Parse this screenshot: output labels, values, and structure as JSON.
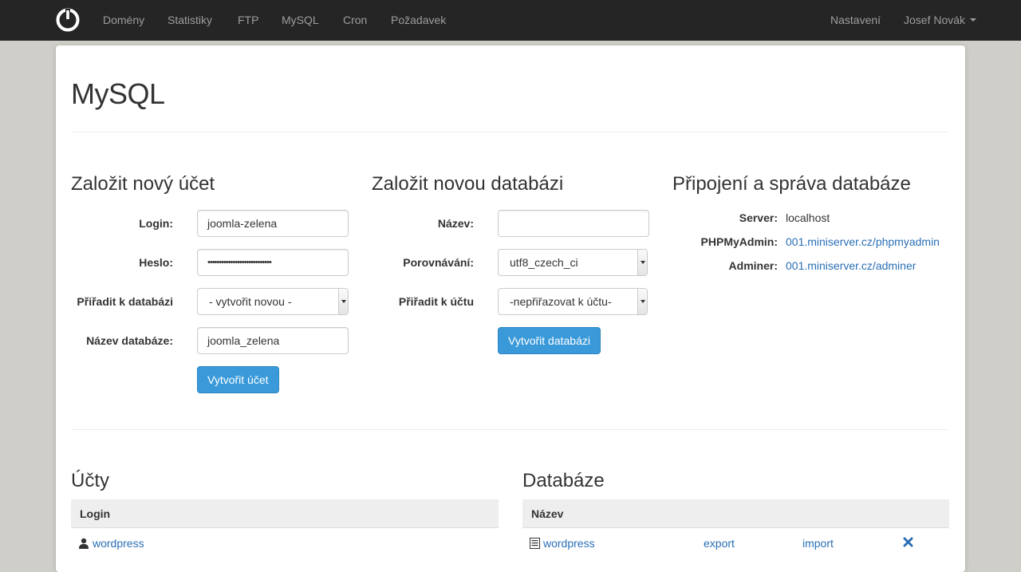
{
  "nav": {
    "items": [
      "Domény",
      "Statistiky",
      "FTP",
      "MySQL",
      "Cron",
      "Požadavek"
    ],
    "settings": "Nastavení",
    "user": "Josef Novák"
  },
  "page": {
    "title": "MySQL"
  },
  "new_account": {
    "title": "Založit nový účet",
    "login_label": "Login:",
    "login_value": "joomla-zelena",
    "password_label": "Heslo:",
    "password_value": "••••••••••••••••••••••••••••",
    "assign_label": "Přiřadit k databázi",
    "assign_value": "- vytvořit novou -",
    "dbname_label": "Název databáze:",
    "dbname_value": "joomla_zelena",
    "submit": "Vytvořit účet"
  },
  "new_database": {
    "title": "Založit novou databázi",
    "name_label": "Název:",
    "name_value": "",
    "collation_label": "Porovnávání:",
    "collation_value": "utf8_czech_ci",
    "assign_label": "Přiřadit k účtu",
    "assign_value": "-nepřiřazovat k účtu-",
    "submit": "Vytvořit databázi"
  },
  "connection": {
    "title": "Připojení a správa databáze",
    "server_label": "Server:",
    "server_value": "localhost",
    "phpmyadmin_label": "PHPMyAdmin:",
    "phpmyadmin_value": "001.miniserver.cz/phpmyadmin",
    "adminer_label": "Adminer:",
    "adminer_value": "001.miniserver.cz/adminer"
  },
  "accounts": {
    "title": "Účty",
    "header_login": "Login",
    "rows": [
      {
        "login": "wordpress"
      }
    ]
  },
  "databases": {
    "title": "Databáze",
    "header_name": "Název",
    "rows": [
      {
        "name": "wordpress",
        "export": "export",
        "import": "import"
      }
    ]
  },
  "colors": {
    "navbar": "#252525",
    "primary": "#3a9ad9",
    "link": "#2a6fb5",
    "background": "#cfcec8"
  }
}
